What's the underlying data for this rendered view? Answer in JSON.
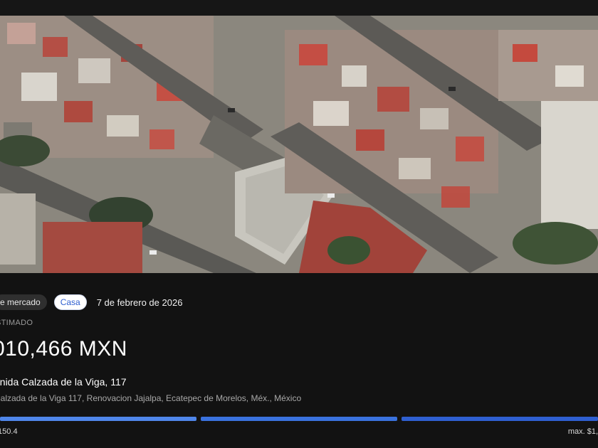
{
  "listing": {
    "market_chip": "e mercado",
    "type_chip": "Casa",
    "date": "7 de febrero de 2026",
    "estimate_label": "STIMADO",
    "price": "010,466 MXN",
    "address_title": "enida Calzada de la Viga, 117",
    "address_full": "Calzada de la Viga 117, Renovacion Jajalpa, Ecatepec de Morelos, Méx., México"
  },
  "range": {
    "min_label": ".150.4",
    "max_label": "max. $1,",
    "segment_colors": [
      "#4f86ea",
      "#3a72de",
      "#2f5fd0"
    ]
  },
  "map": {
    "image": "satellite-view"
  },
  "colors": {
    "background": "#121212",
    "accent": "#3a72de"
  }
}
